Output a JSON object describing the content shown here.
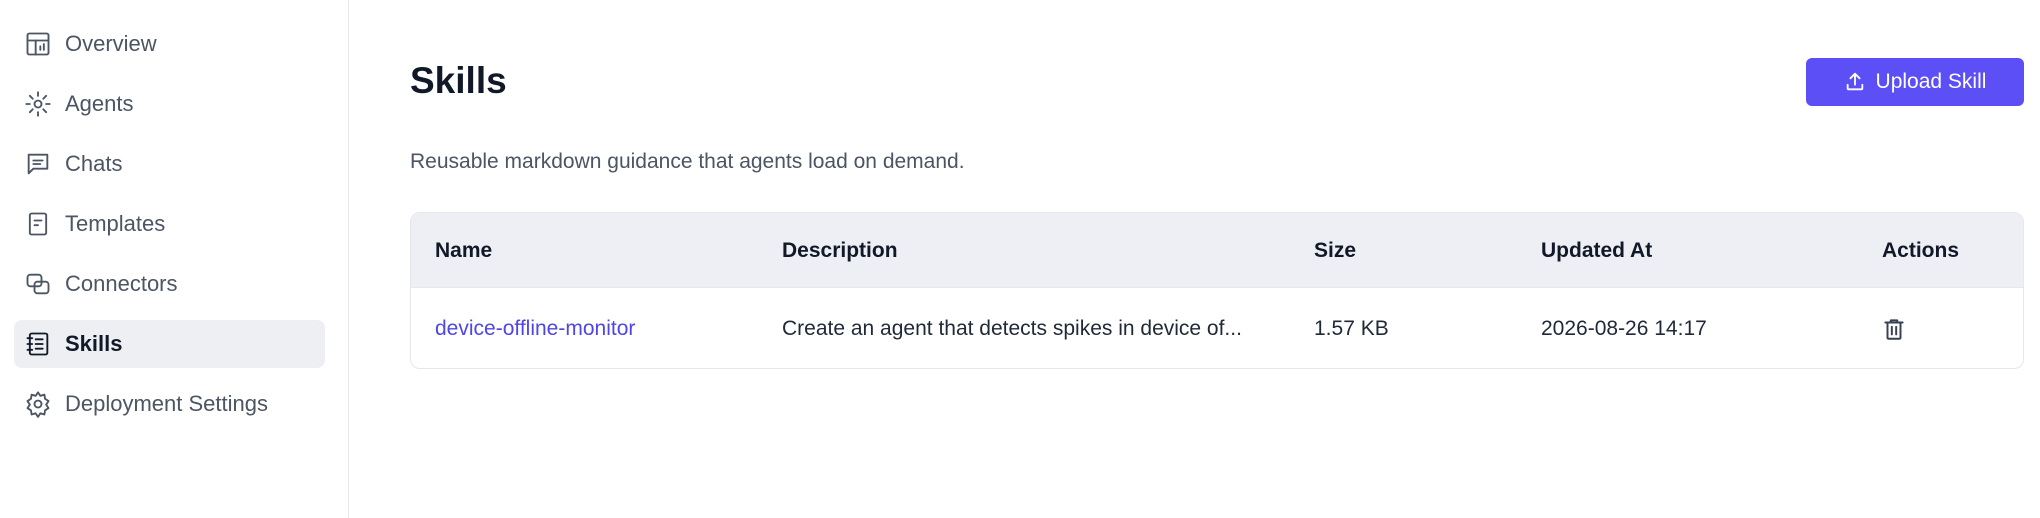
{
  "sidebar": {
    "items": [
      {
        "label": "Overview",
        "icon": "dashboard-icon",
        "active": false
      },
      {
        "label": "Agents",
        "icon": "agents-icon",
        "active": false
      },
      {
        "label": "Chats",
        "icon": "chat-icon",
        "active": false
      },
      {
        "label": "Templates",
        "icon": "template-icon",
        "active": false
      },
      {
        "label": "Connectors",
        "icon": "connectors-icon",
        "active": false
      },
      {
        "label": "Skills",
        "icon": "skills-icon",
        "active": true
      },
      {
        "label": "Deployment Settings",
        "icon": "gear-icon",
        "active": false
      }
    ]
  },
  "main": {
    "title": "Skills",
    "subtitle": "Reusable markdown guidance that agents load on demand.",
    "upload_button": {
      "label": "Upload Skill",
      "icon": "upload-icon"
    },
    "table": {
      "headers": [
        "Name",
        "Description",
        "Size",
        "Updated At",
        "Actions"
      ],
      "rows": [
        {
          "name": "device-offline-monitor",
          "description": "Create an agent that detects spikes in device of...",
          "size": "1.57 KB",
          "updated_at": "2026-08-26 14:17",
          "action_icon": "trash-icon"
        }
      ]
    }
  },
  "colors": {
    "accent": "#5b4ff5",
    "link": "#4f46e5",
    "active_nav_bg": "#eeeff3",
    "table_header_bg": "#eeeff4"
  }
}
